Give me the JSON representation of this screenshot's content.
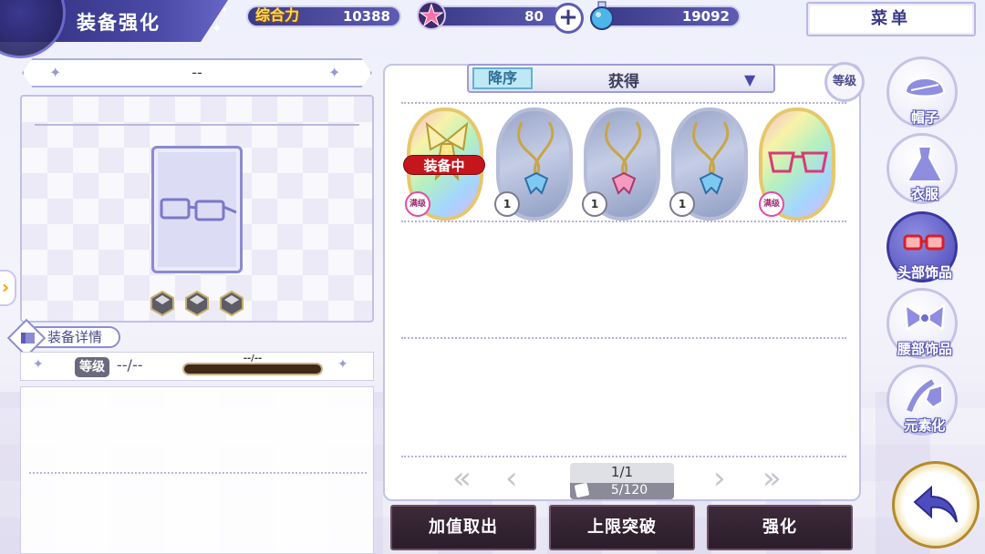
{
  "header": {
    "title": "装备强化",
    "power_label": "综合力",
    "power_value": "10388",
    "stamina_value": "80",
    "currency_value": "19092",
    "menu_label": "菜单"
  },
  "left": {
    "item_name": "--",
    "details_label": "装备详情",
    "level_label": "等级",
    "level_value": "--/--",
    "xp_text": "--/--"
  },
  "center": {
    "sort_order": "降序",
    "sort_value": "获得",
    "level_filter": "等级",
    "equipped_tag": "装备中",
    "items": [
      {
        "style": "rainbow",
        "badge": "满级",
        "equipped": true
      },
      {
        "style": "silver",
        "badge": "1",
        "equipped": false
      },
      {
        "style": "silver",
        "badge": "1",
        "equipped": false
      },
      {
        "style": "silver",
        "badge": "1",
        "equipped": false
      },
      {
        "style": "rainbow",
        "badge": "满级",
        "equipped": false
      }
    ],
    "page": "1/1",
    "count": "5/120"
  },
  "actions": {
    "extract_label": "加值取出",
    "breakthrough_label": "上限突破",
    "enhance_label": "强化"
  },
  "categories": [
    {
      "label": "帽子",
      "icon": "hat-icon",
      "active": false
    },
    {
      "label": "衣服",
      "icon": "dress-icon",
      "active": false
    },
    {
      "label": "头部饰品",
      "icon": "glasses-icon",
      "active": true
    },
    {
      "label": "腰部饰品",
      "icon": "bow-icon",
      "active": false
    },
    {
      "label": "元素化",
      "icon": "element-icon",
      "active": false
    }
  ],
  "colors": {
    "accent": "#4b4aa6",
    "equipped": "#c4161c",
    "action_button": "#2b1d2b"
  }
}
